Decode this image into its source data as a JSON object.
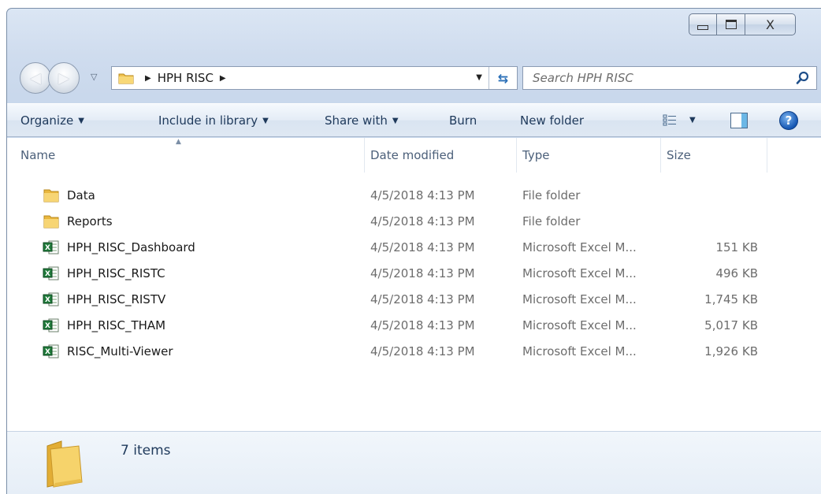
{
  "window": {
    "caption": {
      "minimize": "minimize",
      "maximize": "maximize",
      "close": "X"
    }
  },
  "address": {
    "path": [
      "HPH RISC"
    ],
    "search_placeholder": "Search HPH RISC"
  },
  "toolbar": {
    "organize": "Organize",
    "include_in_library": "Include in library",
    "share_with": "Share with",
    "burn": "Burn",
    "new_folder": "New folder"
  },
  "columns": {
    "name": "Name",
    "date_modified": "Date modified",
    "type": "Type",
    "size": "Size"
  },
  "files": [
    {
      "name": "Data",
      "date": "4/5/2018 4:13 PM",
      "type": "File folder",
      "size": "",
      "icon": "folder-icon"
    },
    {
      "name": "Reports",
      "date": "4/5/2018 4:13 PM",
      "type": "File folder",
      "size": "",
      "icon": "folder-icon"
    },
    {
      "name": "HPH_RISC_Dashboard",
      "date": "4/5/2018 4:13 PM",
      "type": "Microsoft Excel M...",
      "size": "151 KB",
      "icon": "excel-file-icon"
    },
    {
      "name": "HPH_RISC_RISTC",
      "date": "4/5/2018 4:13 PM",
      "type": "Microsoft Excel M...",
      "size": "496 KB",
      "icon": "excel-file-icon"
    },
    {
      "name": "HPH_RISC_RISTV",
      "date": "4/5/2018 4:13 PM",
      "type": "Microsoft Excel M...",
      "size": "1,745 KB",
      "icon": "excel-file-icon"
    },
    {
      "name": "HPH_RISC_THAM",
      "date": "4/5/2018 4:13 PM",
      "type": "Microsoft Excel M...",
      "size": "5,017 KB",
      "icon": "excel-file-icon"
    },
    {
      "name": "RISC_Multi-Viewer",
      "date": "4/5/2018 4:13 PM",
      "type": "Microsoft Excel M...",
      "size": "1,926 KB",
      "icon": "excel-file-icon"
    }
  ],
  "details": {
    "item_count": "7 items"
  },
  "colors": {
    "accent": "#1e395b",
    "folder": "#f1c75b",
    "excel": "#1f7a3a"
  }
}
